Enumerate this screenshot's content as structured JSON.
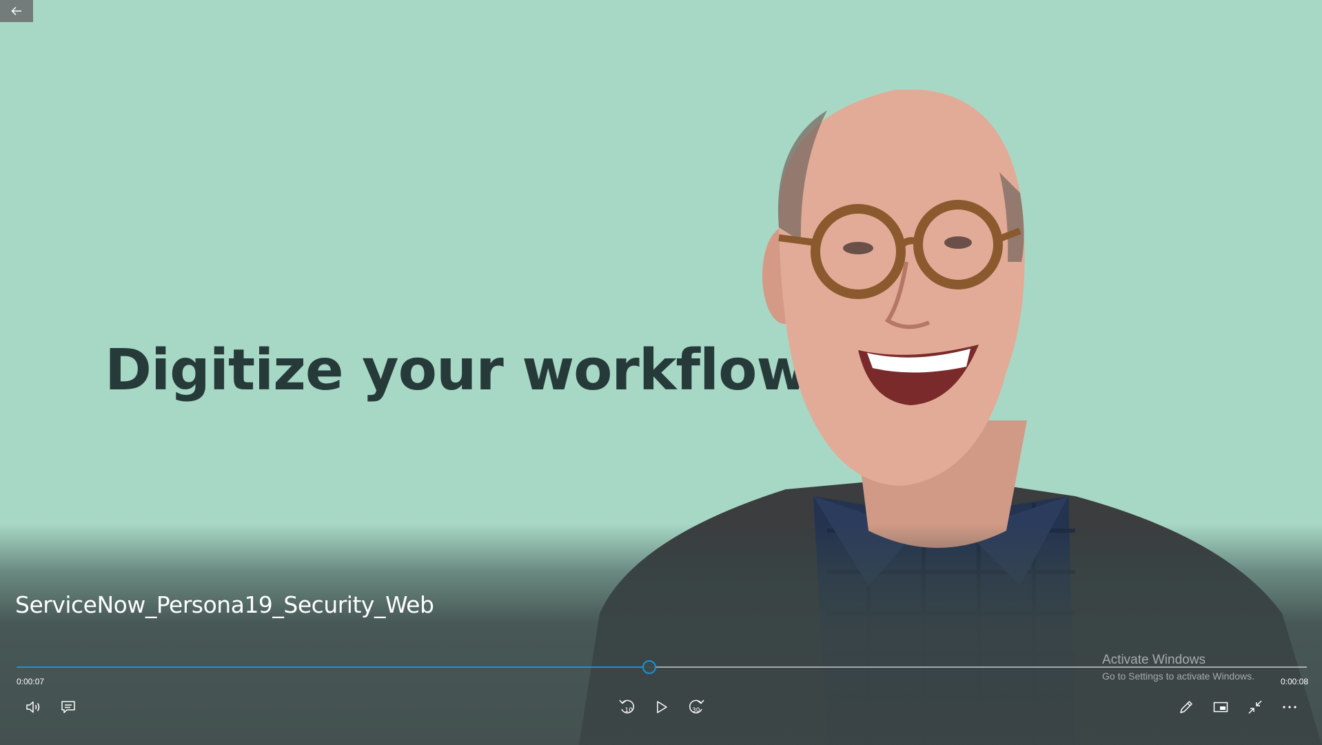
{
  "window": {
    "back_icon": "arrow-left-icon"
  },
  "video": {
    "headline": "Digitize your workflows.",
    "background_color": "#a7d8c5",
    "headline_color": "#273a3a",
    "title": "ServiceNow_Persona19_Security_Web"
  },
  "playback": {
    "current_time": "0:00:07",
    "total_time": "0:00:08",
    "progress_fraction": 0.49,
    "accent_color": "#1e90d6"
  },
  "controls": {
    "left": [
      "volume-icon",
      "captions-icon"
    ],
    "center": [
      "skip-back-10-icon",
      "play-icon",
      "skip-forward-30-icon"
    ],
    "right": [
      "pen-icon",
      "mini-view-icon",
      "exit-fullscreen-icon",
      "more-options-icon"
    ],
    "skip_back_label": "10",
    "skip_forward_label": "30"
  },
  "watermark": {
    "title": "Activate Windows",
    "subtitle": "Go to Settings to activate Windows."
  }
}
